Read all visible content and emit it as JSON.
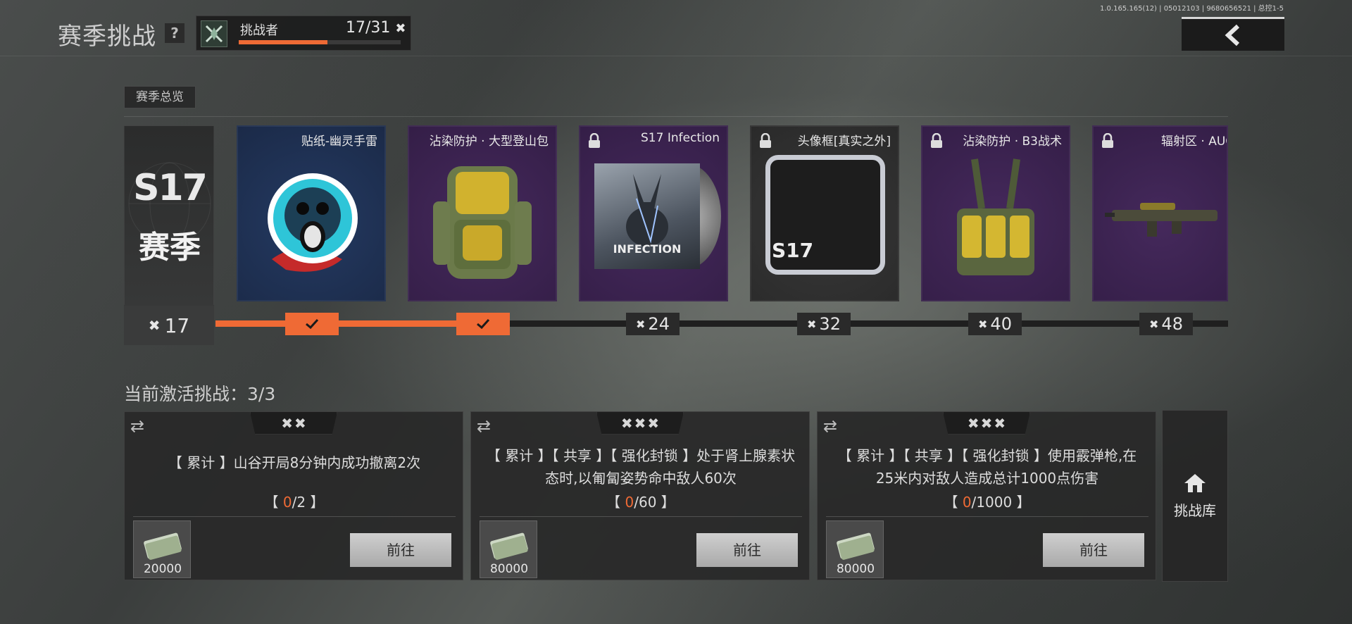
{
  "header": {
    "title": "赛季挑战",
    "help": "?",
    "rank_name": "挑战者",
    "rank_count": "17/31",
    "rank_progress": 0.548,
    "version": "1.0.165.165(12) | 05012103 | 9680656521 | 总控1-5"
  },
  "overview": {
    "tag": "赛季总览",
    "season_code": "S17",
    "season_label": "赛季",
    "current_level": "17",
    "rewards": [
      {
        "name": "贴纸-幽灵手雷",
        "locked": false,
        "level": "",
        "claimed": true
      },
      {
        "name": "沾染防护 · 大型登山包",
        "locked": false,
        "level": "",
        "claimed": true
      },
      {
        "name": "S17 Infection",
        "locked": true,
        "level": "24",
        "claimed": false
      },
      {
        "name": "头像框[真实之外]",
        "locked": true,
        "level": "32",
        "claimed": false
      },
      {
        "name": "沾染防护 · B3战术",
        "locked": true,
        "level": "40",
        "claimed": false
      },
      {
        "name": "辐射区 · AUG",
        "locked": true,
        "level": "48",
        "claimed": false
      }
    ],
    "track_progress": 0.246,
    "infection_text": "INFECTION",
    "frame_text": "S17"
  },
  "challenges": {
    "active_label": "当前激活挑战：3/3",
    "items": [
      {
        "stars": 2,
        "desc": "【 累计 】山谷开局8分钟内成功撤离2次",
        "cur": "0",
        "total": "/2",
        "reward": "20000",
        "go": "前往"
      },
      {
        "stars": 3,
        "desc": "【 累计 】【 共享 】【 强化封锁 】处于肾上腺素状态时,以匍匐姿势命中敌人60次",
        "cur": "0",
        "total": "/60",
        "reward": "80000",
        "go": "前往"
      },
      {
        "stars": 3,
        "desc": "【 累计 】【 共享 】【 强化封锁 】使用霰弹枪,在25米内对敌人造成总计1000点伤害",
        "cur": "0",
        "total": "/1000",
        "reward": "80000",
        "go": "前往"
      }
    ],
    "library_label": "挑战库"
  },
  "icons": {
    "back": "back-arrow-icon",
    "swap": "swap-icon",
    "lock": "lock-icon",
    "check": "check-icon",
    "star": "star-icon",
    "home": "home-icon"
  },
  "colors": {
    "accent": "#ef6a35",
    "blue_card": "#1b2a48",
    "purple_card": "#341e47"
  }
}
